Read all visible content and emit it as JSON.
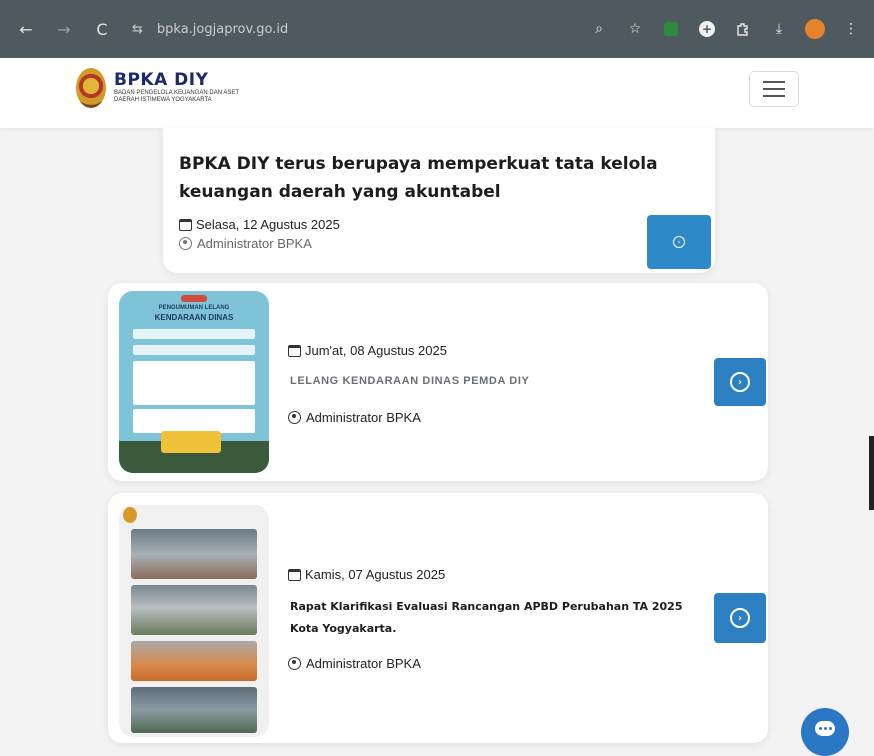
{
  "browser": {
    "url": "bpka.jogjaprov.go.id",
    "back": "←",
    "forward": "→",
    "reload": "C",
    "tune": "⇆",
    "zoom": "⌕",
    "star": "☆",
    "download": "⤓",
    "more": "⋮"
  },
  "header": {
    "brand_title": "BPKA DIY",
    "brand_subtitle_line1": "BADAN PENGELOLA KEUANGAN DAN ASET",
    "brand_subtitle_line2": "DAERAH ISTIMEWA YOGYAKARTA"
  },
  "posts": [
    {
      "title": "BPKA DIY terus berupaya memperkuat tata kelola keuangan daerah yang akuntabel",
      "date": "Selasa, 12 Agustus 2025",
      "author": "Administrator BPKA"
    },
    {
      "title": "LELANG KENDARAAN DINAS PEMDA DIY",
      "date": "Jum'at, 08 Agustus 2025",
      "author": "Administrator BPKA",
      "thumb_heading_small": "PENGUMUMAN LELANG",
      "thumb_heading_large": "KENDARAAN DINAS"
    },
    {
      "title": "Rapat Klarifikasi Evaluasi Rancangan APBD Perubahan TA 2025 Kota Yogyakarta.",
      "date": "Kamis, 07 Agustus 2025",
      "author": "Administrator BPKA"
    }
  ],
  "colors": {
    "brand_blue": "#1b2a6b",
    "button_blue": "#2c7fc0",
    "browser_bar": "#4f5a60"
  }
}
